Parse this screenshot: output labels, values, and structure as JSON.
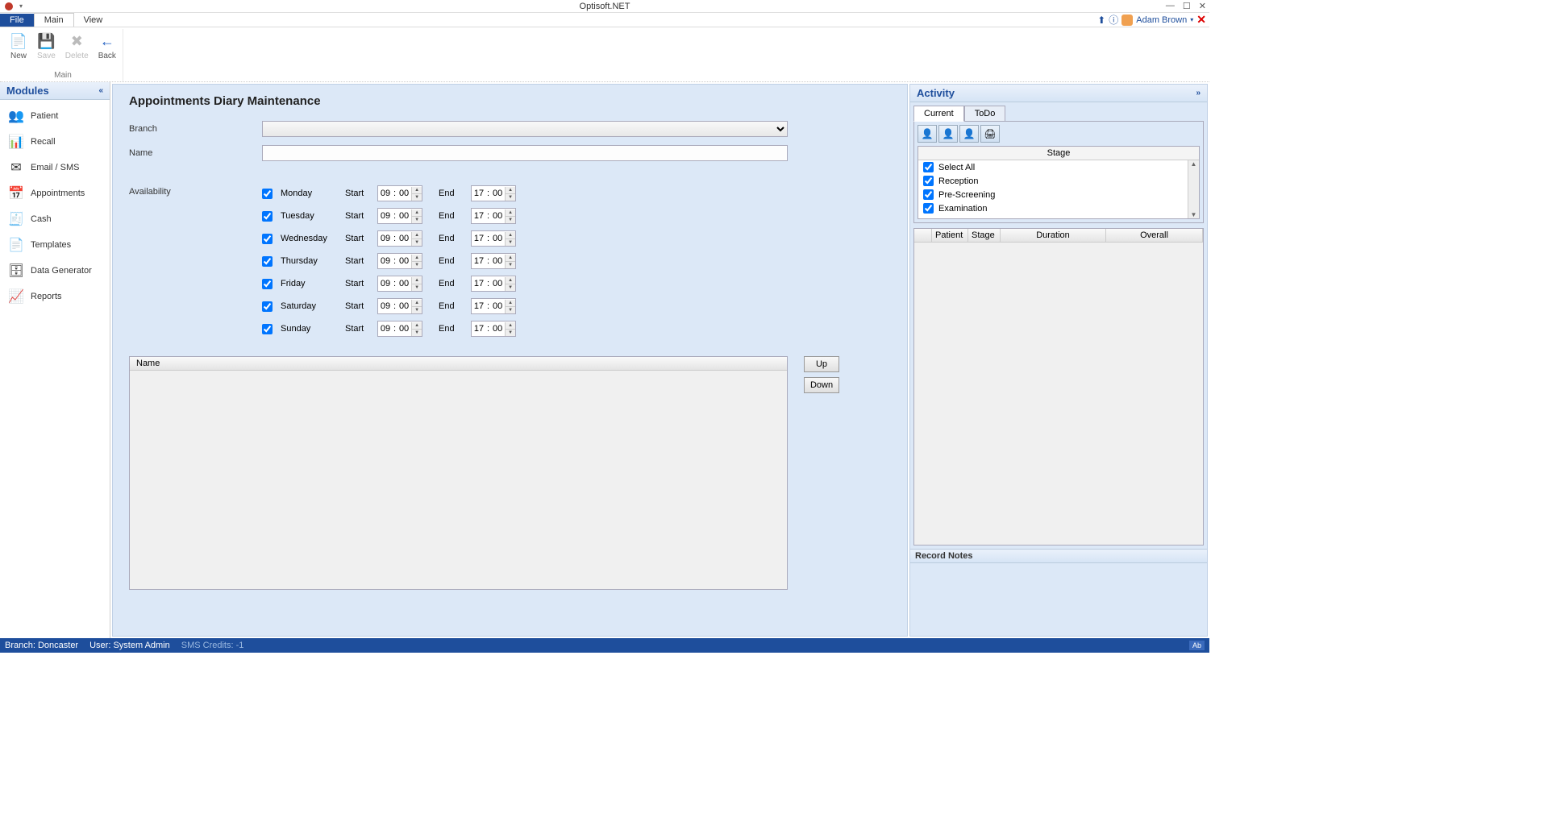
{
  "app": {
    "title": "Optisoft.NET"
  },
  "menubar": {
    "file": "File",
    "main": "Main",
    "view": "View",
    "user": "Adam Brown"
  },
  "ribbon": {
    "group_label": "Main",
    "new": "New",
    "save": "Save",
    "delete": "Delete",
    "back": "Back"
  },
  "modules": {
    "header": "Modules",
    "items": [
      {
        "label": "Patient",
        "icon": "👥"
      },
      {
        "label": "Recall",
        "icon": "📊"
      },
      {
        "label": "Email / SMS",
        "icon": "✉"
      },
      {
        "label": "Appointments",
        "icon": "📅"
      },
      {
        "label": "Cash",
        "icon": "🧾"
      },
      {
        "label": "Templates",
        "icon": "📄"
      },
      {
        "label": "Data Generator",
        "icon": "🗄"
      },
      {
        "label": "Reports",
        "icon": "📈"
      }
    ]
  },
  "content": {
    "title": "Appointments Diary Maintenance",
    "branch_label": "Branch",
    "name_label": "Name",
    "branch_value": "",
    "name_value": "",
    "availability_label": "Availability",
    "start_label": "Start",
    "end_label": "End",
    "days": [
      {
        "name": "Monday",
        "checked": true,
        "sh": "09",
        "sm": "00",
        "eh": "17",
        "em": "00"
      },
      {
        "name": "Tuesday",
        "checked": true,
        "sh": "09",
        "sm": "00",
        "eh": "17",
        "em": "00"
      },
      {
        "name": "Wednesday",
        "checked": true,
        "sh": "09",
        "sm": "00",
        "eh": "17",
        "em": "00"
      },
      {
        "name": "Thursday",
        "checked": true,
        "sh": "09",
        "sm": "00",
        "eh": "17",
        "em": "00"
      },
      {
        "name": "Friday",
        "checked": true,
        "sh": "09",
        "sm": "00",
        "eh": "17",
        "em": "00"
      },
      {
        "name": "Saturday",
        "checked": true,
        "sh": "09",
        "sm": "00",
        "eh": "17",
        "em": "00"
      },
      {
        "name": "Sunday",
        "checked": true,
        "sh": "09",
        "sm": "00",
        "eh": "17",
        "em": "00"
      }
    ],
    "list_col": "Name",
    "up": "Up",
    "down": "Down"
  },
  "activity": {
    "header": "Activity",
    "tab_current": "Current",
    "tab_todo": "ToDo",
    "stage_header": "Stage",
    "stages": [
      {
        "label": "Select All",
        "checked": true
      },
      {
        "label": "Reception",
        "checked": true
      },
      {
        "label": "Pre-Screening",
        "checked": true
      },
      {
        "label": "Examination",
        "checked": true
      }
    ],
    "grid": {
      "patient": "Patient",
      "stage": "Stage",
      "duration": "Duration",
      "overall": "Overall"
    },
    "notes_header": "Record Notes"
  },
  "status": {
    "branch": "Branch: Doncaster",
    "user": "User: System Admin",
    "sms": "SMS Credits: -1",
    "right_tag": "Ab"
  }
}
